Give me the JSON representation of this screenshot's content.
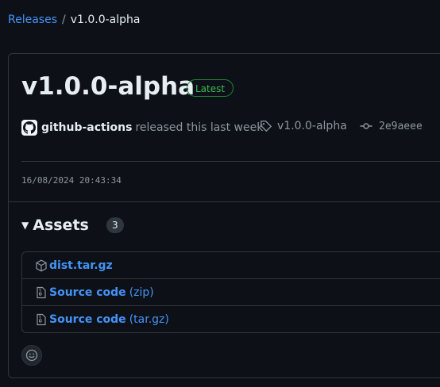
{
  "breadcrumb": {
    "parent": "Releases",
    "separator": "/",
    "current": "v1.0.0-alpha"
  },
  "release": {
    "title": "v1.0.0-alpha",
    "badge": "Latest",
    "author": "github-actions",
    "released_text": "released this last week",
    "tag": "v1.0.0-alpha",
    "commit": "2e9aeee",
    "timestamp": "16/08/2024 20:43:34"
  },
  "assets": {
    "title": "Assets",
    "count": "3",
    "items": [
      {
        "name": "dist.tar.gz",
        "suffix": "",
        "icon": "package-icon"
      },
      {
        "name": "Source code",
        "suffix": "(zip)",
        "icon": "file-zip-icon"
      },
      {
        "name": "Source code",
        "suffix": "(tar.gz)",
        "icon": "file-zip-icon"
      }
    ]
  },
  "icons": {
    "avatar": "github-mark-icon",
    "tag": "tag-icon",
    "commit": "git-commit-icon",
    "reaction": "smiley-icon",
    "disclosure": "triangle-down-icon"
  },
  "colors": {
    "background": "#0d1117",
    "link": "#4493f8",
    "badge_green": "#3fb950",
    "border": "#30363d",
    "muted": "#8d96a0"
  }
}
